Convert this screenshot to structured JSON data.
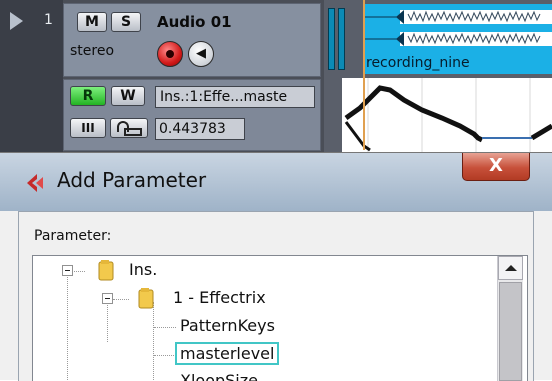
{
  "track": {
    "number": "1",
    "mute_label": "M",
    "solo_label": "S",
    "name": "Audio 01",
    "channel_mode": "stereo",
    "read_label": "R",
    "write_label": "W",
    "automation_param": "Ins.:1:Effe...maste",
    "show_lanes_label": "III",
    "automation_value": "0.443783"
  },
  "arrange": {
    "event_name": "recording_nine"
  },
  "dialog": {
    "title": "Add Parameter",
    "close_glyph": "X",
    "parameter_label": "Parameter:",
    "tree": [
      {
        "label": "Ins.",
        "level": 0,
        "expanded": true
      },
      {
        "label": "1 - Effectrix",
        "level": 1,
        "expanded": true
      },
      {
        "label": "PatternKeys",
        "level": 2
      },
      {
        "label": "masterlevel",
        "level": 2,
        "selected": true
      },
      {
        "label": "XloopSize",
        "level": 2
      }
    ]
  },
  "colors": {
    "record": "#d21a1a",
    "read_active": "#23b323",
    "audio_event": "#1bb0e6",
    "selection_border": "#41c6c6",
    "close_button": "#c7503a"
  },
  "icons": {
    "track_play": "play-triangle-icon",
    "record": "record-icon",
    "monitor": "speaker-icon",
    "lock": "lock-icon",
    "app": "cubase-logo-icon",
    "folder": "folder-icon"
  }
}
